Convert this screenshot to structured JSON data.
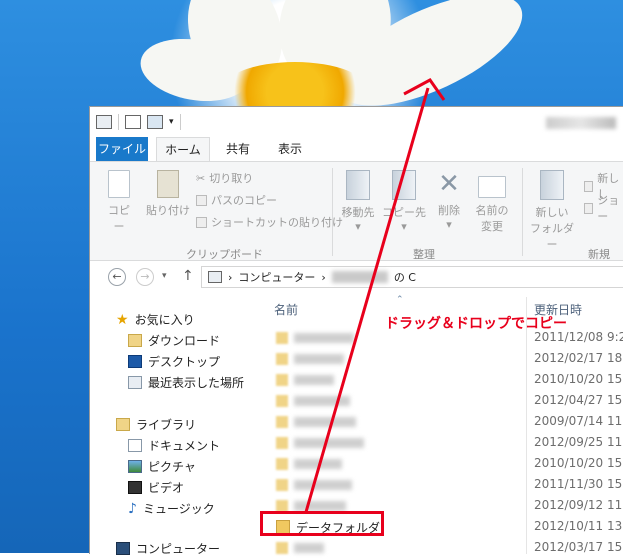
{
  "window": {
    "title_blurred": true
  },
  "tabs": [
    {
      "label": "ファイル"
    },
    {
      "label": "ホーム"
    },
    {
      "label": "共有"
    },
    {
      "label": "表示"
    }
  ],
  "ribbon": {
    "copy": "コピー",
    "paste": "貼り付け",
    "cut": "切り取り",
    "copy_path": "パスのコピー",
    "paste_shortcut": "ショートカットの貼り付け",
    "clipboard_group": "クリップボード",
    "move_to": "移動先",
    "copy_to": "コピー先",
    "delete": "削除",
    "rename_1": "名前の",
    "rename_2": "変更",
    "organize_group": "整理",
    "new_folder_1": "新しい",
    "new_folder_2": "フォルダー",
    "new_item": "新しし",
    "shortcut": "ショー",
    "new_group": "新規"
  },
  "address": {
    "computer": "コンピューター",
    "drive_suffix": "の C"
  },
  "nav": {
    "favorites": "お気に入り",
    "downloads": "ダウンロード",
    "desktop": "デスクトップ",
    "recent": "最近表示した場所",
    "libraries": "ライブラリ",
    "documents": "ドキュメント",
    "pictures": "ピクチャ",
    "videos": "ビデオ",
    "music": "ミュージック",
    "computer": "コンピューター"
  },
  "columns": {
    "name": "名前",
    "date": "更新日時"
  },
  "files": [
    {
      "date": "2011/12/08 9:2"
    },
    {
      "date": "2012/02/17 18:"
    },
    {
      "date": "2010/10/20 15:"
    },
    {
      "date": "2012/04/27 15:"
    },
    {
      "date": "2009/07/14 11:"
    },
    {
      "date": "2012/09/25 11:"
    },
    {
      "date": "2010/10/20 15:"
    },
    {
      "date": "2011/11/30 15:"
    },
    {
      "date": "2012/09/12 11:"
    },
    {
      "name": "データフォルダ",
      "date": "2012/10/11 13:"
    },
    {
      "date": "2012/03/17 15:"
    }
  ],
  "annotation": {
    "text": "ドラッグ＆ドロップでコピー",
    "color": "#e8001c"
  },
  "colors": {
    "accent": "#1979ca",
    "highlight": "#e8001c"
  }
}
